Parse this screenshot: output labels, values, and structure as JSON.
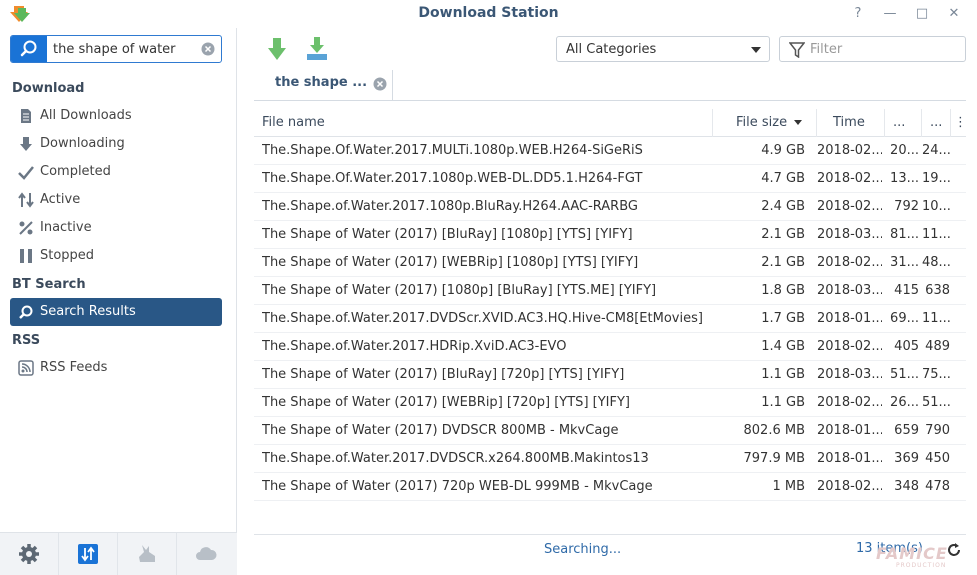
{
  "window": {
    "title": "Download Station",
    "help": "?",
    "minimize": "—",
    "maximize": "□",
    "close": "✕"
  },
  "search": {
    "value": "the shape of water"
  },
  "sidebar": {
    "download_heading": "Download",
    "download_items": [
      {
        "label": "All Downloads",
        "icon": "document-icon"
      },
      {
        "label": "Downloading",
        "icon": "arrow-down-icon"
      },
      {
        "label": "Completed",
        "icon": "checkmark-icon"
      },
      {
        "label": "Active",
        "icon": "up-down-arrows-icon"
      },
      {
        "label": "Inactive",
        "icon": "percent-icon"
      },
      {
        "label": "Stopped",
        "icon": "pause-icon"
      }
    ],
    "bt_heading": "BT Search",
    "bt_items": [
      {
        "label": "Search Results",
        "icon": "search-icon",
        "active": true
      }
    ],
    "rss_heading": "RSS",
    "rss_items": [
      {
        "label": "RSS Feeds",
        "icon": "rss-icon"
      }
    ]
  },
  "toolbar": {
    "category_selected": "All Categories",
    "filter_placeholder": "Filter"
  },
  "tab": {
    "label": "the shape ..."
  },
  "table": {
    "columns": [
      "File name",
      "File size",
      "Time",
      "...",
      "..."
    ],
    "rows": [
      [
        "The.Shape.Of.Water.2017.MULTi.1080p.WEB.H264-SiGeRiS",
        "4.9 GB",
        "2018-02...",
        "20...",
        "24..."
      ],
      [
        "The.Shape.Of.Water.2017.1080p.WEB-DL.DD5.1.H264-FGT",
        "4.7 GB",
        "2018-02...",
        "13...",
        "19..."
      ],
      [
        "The.Shape.of.Water.2017.1080p.BluRay.H264.AAC-RARBG",
        "2.4 GB",
        "2018-02...",
        "792",
        "10..."
      ],
      [
        "The Shape of Water (2017) [BluRay] [1080p] [YTS] [YIFY]",
        "2.1 GB",
        "2018-03...",
        "81...",
        "11..."
      ],
      [
        "The Shape of Water (2017) [WEBRip] [1080p] [YTS] [YIFY]",
        "2.1 GB",
        "2018-02...",
        "31...",
        "48..."
      ],
      [
        "The Shape of Water (2017) [1080p] [BluRay] [YTS.ME] [YIFY]",
        "1.8 GB",
        "2018-03...",
        "415",
        "638"
      ],
      [
        "The.Shape.of.Water.2017.DVDScr.XVID.AC3.HQ.Hive-CM8[EtMovies]",
        "1.7 GB",
        "2018-01...",
        "69...",
        "11..."
      ],
      [
        "The.Shape.of.Water.2017.HDRip.XviD.AC3-EVO",
        "1.4 GB",
        "2018-02...",
        "405",
        "489"
      ],
      [
        "The Shape of Water (2017) [BluRay] [720p] [YTS] [YIFY]",
        "1.1 GB",
        "2018-03...",
        "51...",
        "75..."
      ],
      [
        "The Shape of Water (2017) [WEBRip] [720p] [YTS] [YIFY]",
        "1.1 GB",
        "2018-02...",
        "26...",
        "51..."
      ],
      [
        "The Shape of Water (2017) DVDSCR 800MB - MkvCage",
        "802.6 MB",
        "2018-01...",
        "659",
        "790"
      ],
      [
        "The.Shape.of.Water.2017.DVDSCR.x264.800MB.Makintos13",
        "797.9 MB",
        "2018-01...",
        "369",
        "450"
      ],
      [
        "The Shape of Water (2017) 720p WEB-DL 999MB - MkvCage",
        "1 MB",
        "2018-02...",
        "348",
        "478"
      ]
    ]
  },
  "status": {
    "text": "Searching...",
    "count": "13 item(s)"
  },
  "watermark": {
    "line1": "FAMICE",
    "line2": "PRODUCTION"
  },
  "colors": {
    "accent": "#1a73d6",
    "active_nav": "#295786",
    "title": "#3b5775",
    "download_green": "#5cb85c"
  }
}
